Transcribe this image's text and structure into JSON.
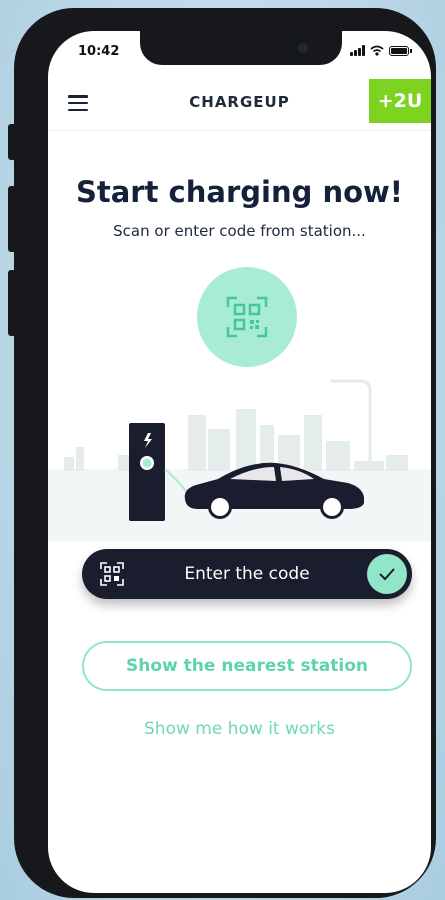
{
  "status_bar": {
    "time": "10:42"
  },
  "header": {
    "logo_text": "CHARGEUP",
    "plus_button_label": "+2U",
    "accent_color": "#7ed321"
  },
  "main": {
    "title": "Start charging now!",
    "subtitle": "Scan or enter code from station...",
    "enter_code_label": "Enter the code",
    "nearest_station_label": "Show the nearest station",
    "how_it_works_label": "Show me how it works"
  },
  "icons": {
    "menu": "hamburger-icon",
    "scan": "qr-scan-icon",
    "confirm": "checkmark-icon",
    "charger": "lightning-icon"
  },
  "colors": {
    "mint": "#8fe6c9",
    "dark": "#1a1d2e",
    "brand_green": "#7ed321"
  }
}
